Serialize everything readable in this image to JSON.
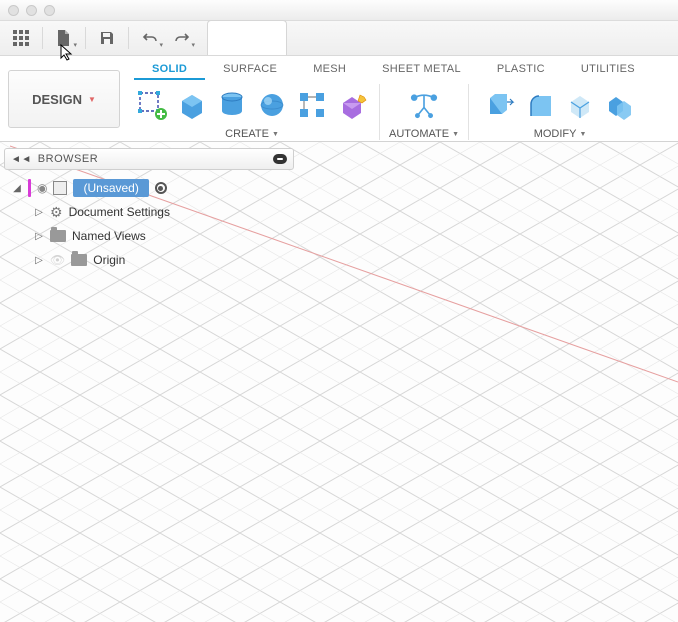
{
  "workspace": {
    "label": "DESIGN"
  },
  "tabs": {
    "solid": "SOLID",
    "surface": "SURFACE",
    "mesh": "MESH",
    "sheetmetal": "SHEET METAL",
    "plastic": "PLASTIC",
    "utilities": "UTILITIES",
    "active": "solid"
  },
  "ribbon_groups": {
    "create": "CREATE",
    "automate": "AUTOMATE",
    "modify": "MODIFY"
  },
  "browser": {
    "title": "BROWSER",
    "root": "(Unsaved)",
    "items": [
      {
        "label": "Document Settings",
        "icon": "gear"
      },
      {
        "label": "Named Views",
        "icon": "folder"
      },
      {
        "label": "Origin",
        "icon": "folder"
      }
    ]
  }
}
